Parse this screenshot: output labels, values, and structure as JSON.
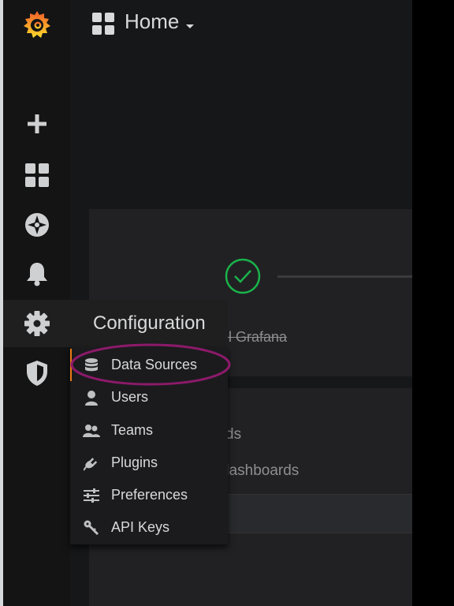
{
  "header": {
    "title": "Home",
    "dashboard_icon": "dashboard-grid-icon",
    "caret_icon": "caret-down-icon"
  },
  "sidebar": {
    "items": [
      {
        "name": "grafana-logo",
        "icon": "grafana-logo-icon"
      },
      {
        "name": "create",
        "icon": "plus-icon"
      },
      {
        "name": "dashboards",
        "icon": "dashboard-grid-icon"
      },
      {
        "name": "explore",
        "icon": "compass-icon"
      },
      {
        "name": "alerting",
        "icon": "bell-icon"
      },
      {
        "name": "configuration",
        "icon": "gear-icon",
        "active": true
      },
      {
        "name": "server-admin",
        "icon": "shield-icon"
      }
    ]
  },
  "config_menu": {
    "title": "Configuration",
    "items": [
      {
        "label": "Data Sources",
        "icon": "database-icon",
        "selected": true
      },
      {
        "label": "Users",
        "icon": "user-icon"
      },
      {
        "label": "Teams",
        "icon": "team-icon"
      },
      {
        "label": "Plugins",
        "icon": "plug-icon"
      },
      {
        "label": "Preferences",
        "icon": "sliders-icon"
      },
      {
        "label": "API Keys",
        "icon": "key-icon"
      }
    ]
  },
  "background": {
    "install_step": "ll Grafana",
    "row1": "ds",
    "row2": "dashboards"
  },
  "colors": {
    "accent_orange": "#eb7b18",
    "check_green": "#1ab34a",
    "annotation_magenta": "#8c1a6a",
    "text": "#d8d9da"
  }
}
